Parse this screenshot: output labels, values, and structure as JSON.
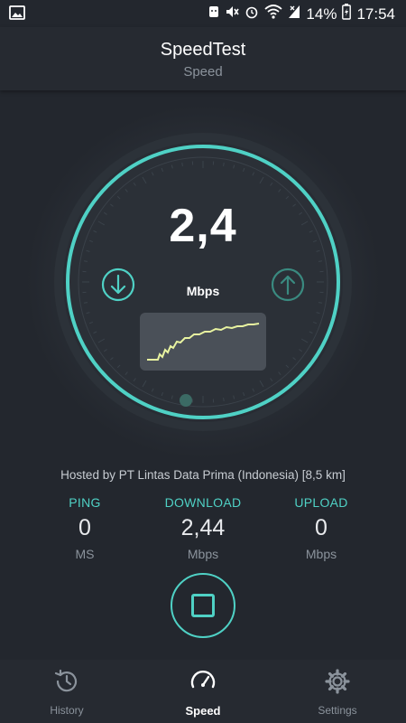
{
  "status_bar": {
    "battery": "14%",
    "time": "17:54"
  },
  "header": {
    "title": "SpeedTest",
    "subtitle": "Speed"
  },
  "gauge": {
    "speed_value": "2,4",
    "speed_unit": "Mbps",
    "accent_color": "#4fd1c5",
    "graph_color": "#e8f3a0"
  },
  "server": {
    "text": "Hosted by PT Lintas Data Prima (Indonesia) [8,5 km]"
  },
  "stats": {
    "ping": {
      "label": "PING",
      "value": "0",
      "unit": "MS"
    },
    "download": {
      "label": "DOWNLOAD",
      "value": "2,44",
      "unit": "Mbps"
    },
    "upload": {
      "label": "UPLOAD",
      "value": "0",
      "unit": "Mbps"
    }
  },
  "nav": {
    "history": "History",
    "speed": "Speed",
    "settings": "Settings"
  }
}
